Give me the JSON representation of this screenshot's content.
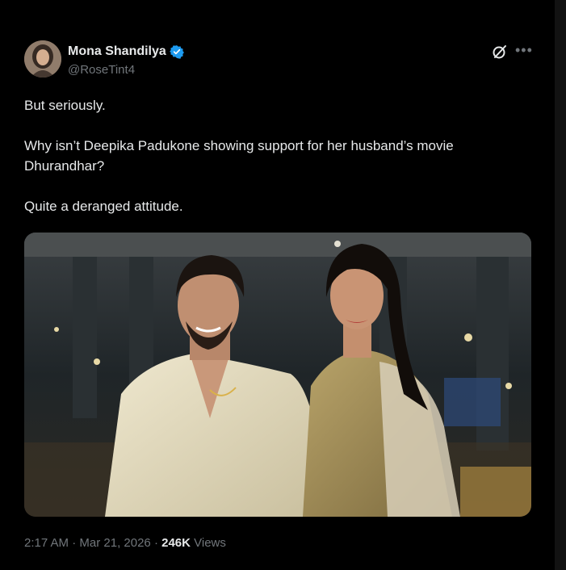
{
  "tweet": {
    "author_name": "Mona Shandilya",
    "handle": "@RoseTint4",
    "verified": true,
    "text": {
      "line1": "But seriously.",
      "line2a": "Why isn’t Deepika Padukone showing support for her husband’s movie",
      "line2b": "Dhurandhar?",
      "line3": "Quite a deranged attitude."
    },
    "time": "2:17 AM",
    "separator1": " · ",
    "date": "Mar 21, 2026",
    "separator2": " · ",
    "views_count": "246K",
    "views_label": " Views"
  },
  "icons": {
    "verified": "verified-badge-icon",
    "grok": "grok-icon",
    "more": "more-options-icon"
  },
  "colors": {
    "background": "#000000",
    "text_primary": "#e7e9ea",
    "text_secondary": "#71767b",
    "verified_blue": "#1d9bf0"
  }
}
